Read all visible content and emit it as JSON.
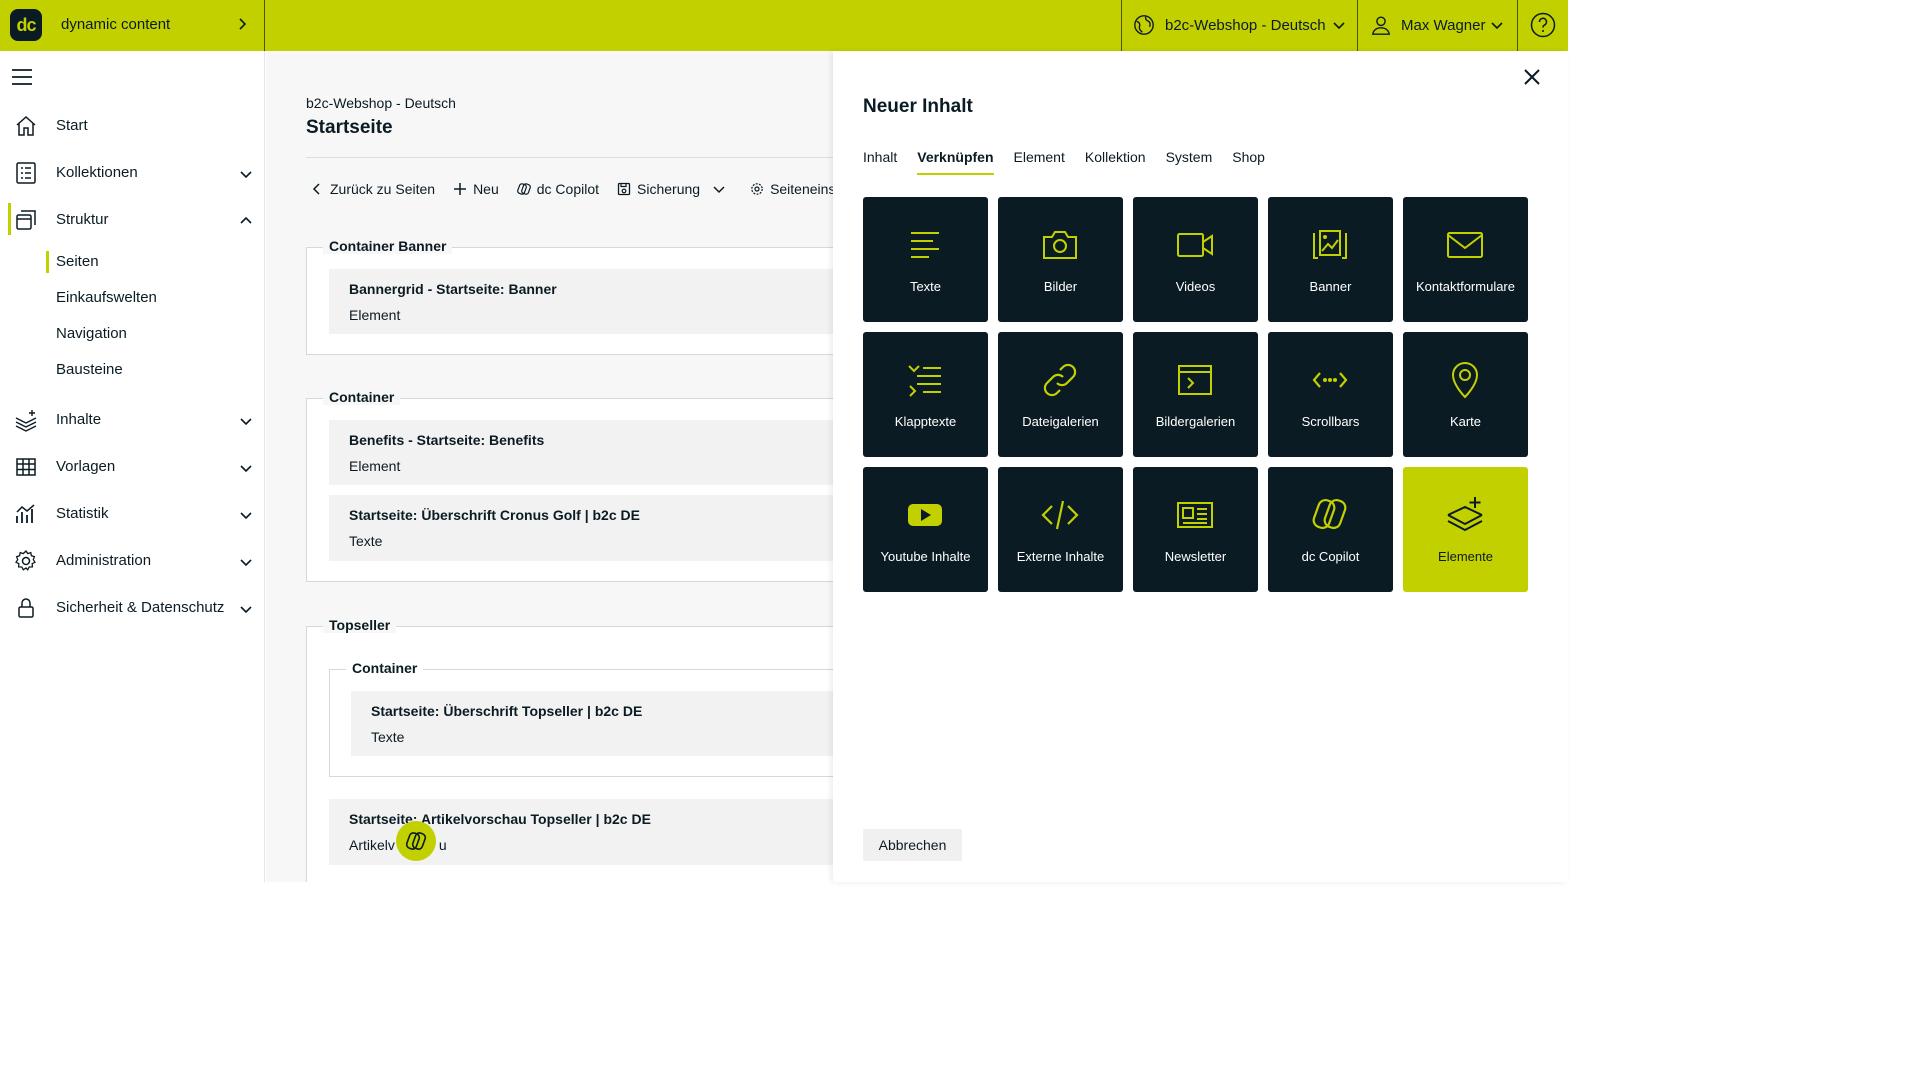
{
  "topbar": {
    "logo": "dc",
    "brand": "dynamic content",
    "shop": "b2c-Webshop - Deutsch",
    "user": "Max Wagner"
  },
  "sidebar": {
    "items": [
      {
        "label": "Start",
        "icon": "home-icon"
      },
      {
        "label": "Kollektionen",
        "icon": "collection-icon"
      },
      {
        "label": "Struktur",
        "icon": "structure-icon"
      },
      {
        "label": "Inhalte",
        "icon": "content-icon"
      },
      {
        "label": "Vorlagen",
        "icon": "template-icon"
      },
      {
        "label": "Statistik",
        "icon": "statistics-icon"
      },
      {
        "label": "Administration",
        "icon": "gear-icon"
      },
      {
        "label": "Sicherheit & Datenschutz",
        "icon": "lock-icon"
      }
    ],
    "subitems": [
      "Seiten",
      "Einkaufswelten",
      "Navigation",
      "Bausteine"
    ]
  },
  "main": {
    "breadcrumb": "b2c-Webshop - Deutsch",
    "title": "Startseite",
    "toolbar": {
      "back": "Zurück zu Seiten",
      "new": "Neu",
      "copilot": "dc Copilot",
      "backup": "Sicherung",
      "settings": "Seiteneinstell"
    },
    "groups": [
      {
        "legend": "Container Banner",
        "cards": [
          {
            "title": "Bannergrid - Startseite: Banner",
            "type": "Element"
          }
        ]
      },
      {
        "legend": "Container",
        "cards": [
          {
            "title": "Benefits - Startseite: Benefits",
            "type": "Element"
          },
          {
            "title": "Startseite: Überschrift Cronus Golf | b2c DE",
            "type": "Texte"
          }
        ]
      },
      {
        "legend": "Topseller",
        "inner_legend": "Container",
        "cards": [
          {
            "title": "Startseite: Überschrift Topseller | b2c DE",
            "type": "Texte"
          },
          {
            "title": "Startseite: Artikelvorschau Topseller | b2c DE",
            "type_a": "Artikelv",
            "type_b": "u"
          }
        ]
      }
    ]
  },
  "panel": {
    "title": "Neuer Inhalt",
    "tabs": [
      "Inhalt",
      "Verknüpfen",
      "Element",
      "Kollektion",
      "System",
      "Shop"
    ],
    "active_tab": "Verknüpfen",
    "tiles": [
      {
        "label": "Texte",
        "icon": "text-lines-icon"
      },
      {
        "label": "Bilder",
        "icon": "camera-icon"
      },
      {
        "label": "Videos",
        "icon": "video-icon"
      },
      {
        "label": "Banner",
        "icon": "banner-icon"
      },
      {
        "label": "Kontaktformulare",
        "icon": "mail-icon"
      },
      {
        "label": "Klapptexte",
        "icon": "accordion-icon"
      },
      {
        "label": "Dateigalerien",
        "icon": "link-icon"
      },
      {
        "label": "Bildergalerien",
        "icon": "gallery-icon"
      },
      {
        "label": "Scrollbars",
        "icon": "scroll-arrows-icon"
      },
      {
        "label": "Karte",
        "icon": "map-pin-icon"
      },
      {
        "label": "Youtube Inhalte",
        "icon": "youtube-icon"
      },
      {
        "label": "Externe Inhalte",
        "icon": "code-icon"
      },
      {
        "label": "Newsletter",
        "icon": "newsletter-icon"
      },
      {
        "label": "dc Copilot",
        "icon": "copilot-icon"
      },
      {
        "label": "Elemente",
        "icon": "layers-plus-icon"
      }
    ],
    "cancel": "Abbrechen"
  },
  "colors": {
    "accent": "#c3d000",
    "dark": "#0b1b24"
  }
}
